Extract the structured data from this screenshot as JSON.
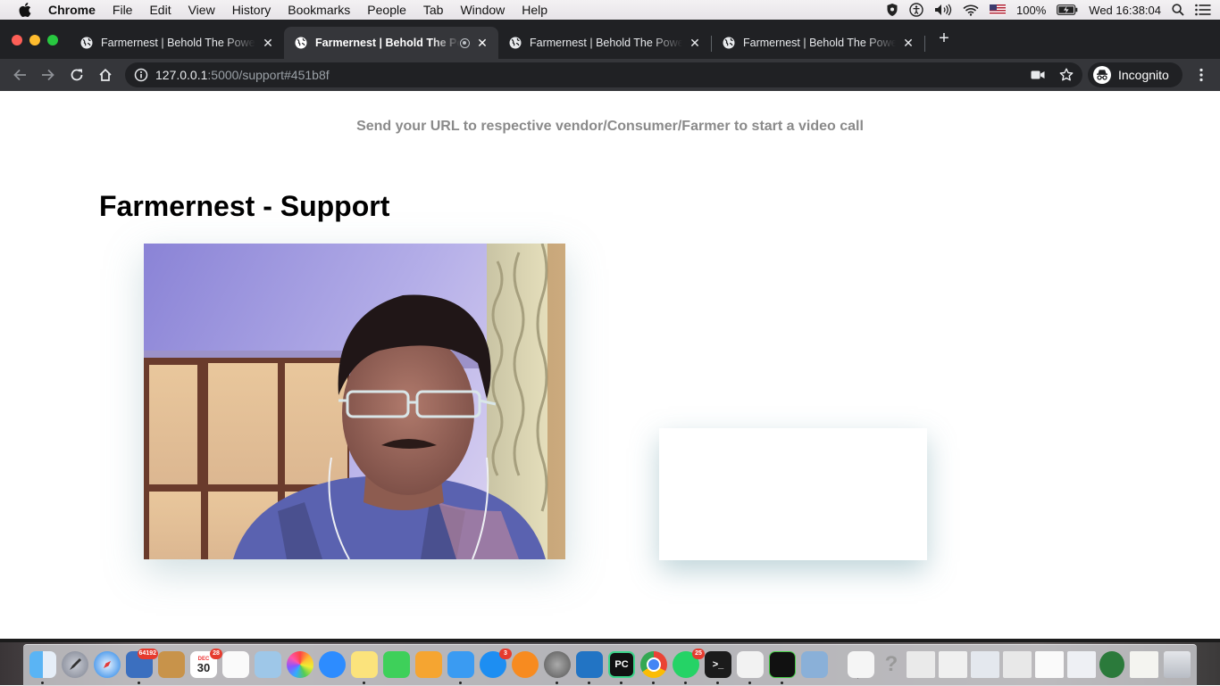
{
  "menubar": {
    "items": [
      "Chrome",
      "File",
      "Edit",
      "View",
      "History",
      "Bookmarks",
      "People",
      "Tab",
      "Window",
      "Help"
    ],
    "status": {
      "battery": "100%",
      "clock": "Wed 16:38:04"
    }
  },
  "tabs": [
    {
      "title": "Farmernest | Behold The Power"
    },
    {
      "title": "Farmernest | Behold The Power"
    },
    {
      "title": "Farmernest | Behold The Power"
    },
    {
      "title": "Farmernest | Behold The Power"
    }
  ],
  "toolbar": {
    "url_host": "127.0.0.1",
    "url_rest": ":5000/support#451b8f",
    "profile_label": "Incognito"
  },
  "page": {
    "notice": "Send your URL to respective vendor/Consumer/Farmer to start a video call",
    "title": "Farmernest - Support"
  },
  "dock": {
    "badges": {
      "photos_app": "64192",
      "calendar_day": "30",
      "calendar_month": "DEC",
      "calendar_badge": "28",
      "app_store": "3",
      "whatsapp": "25"
    }
  },
  "colors": {
    "menubar": "#e9e6ea",
    "tabstrip": "#202124",
    "toolbar": "#35363a",
    "notice_text": "#8a8a8a"
  }
}
